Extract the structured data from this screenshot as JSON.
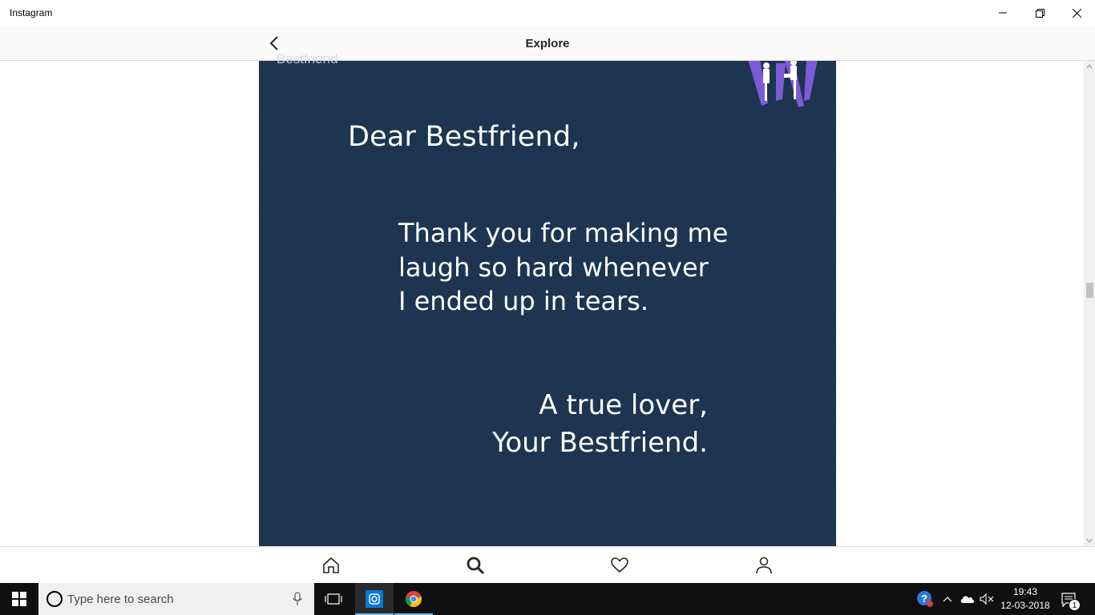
{
  "window": {
    "title": "Instagram"
  },
  "header": {
    "title": "Explore",
    "ghost_left": "Bestfriend"
  },
  "post": {
    "greeting": "Dear Bestfriend,",
    "body_lines": [
      "Thank you for making me",
      "laugh so hard whenever",
      "I ended up in tears."
    ],
    "sign_lines": [
      "A true lover,",
      "Your Bestfriend."
    ],
    "background": "#1d3551"
  },
  "nav": {
    "items": [
      "home-icon",
      "search-icon",
      "heart-icon",
      "profile-icon"
    ],
    "active": "search-icon"
  },
  "taskbar": {
    "search_placeholder": "Type here to search",
    "time": "19:43",
    "date": "12-03-2018",
    "notification_count": "1"
  }
}
